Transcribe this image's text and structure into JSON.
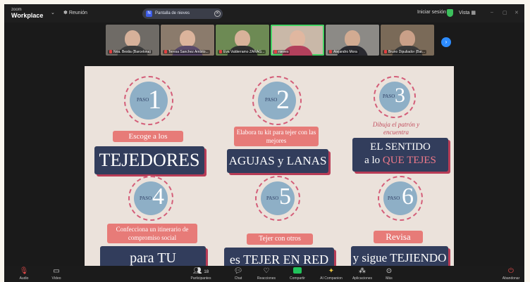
{
  "app": {
    "brand_line1": "zoom",
    "brand_line2": "Workplace"
  },
  "topbar": {
    "meeting_label": "Reunión",
    "share_badge": "N",
    "share_label": "Pantalla de nieves",
    "signin_label": "Iniciar sesión",
    "view_label": "Vista"
  },
  "participants": [
    {
      "name": "Nria. Bestia (Barcelona)",
      "bg": "#6f6b66",
      "skin": "#d6b19a",
      "shirt": "#3c3c3c"
    },
    {
      "name": "Teresa Sanchez Ambito...",
      "bg": "#8b7b6c",
      "skin": "#dcb49c",
      "shirt": "#5a4a6a"
    },
    {
      "name": "Eva Valderramo ZARAG...",
      "bg": "#6d8a54",
      "skin": "#d8b29a",
      "shirt": "#2f2f2f"
    },
    {
      "name": "nieves",
      "bg": "#c9b8a8",
      "skin": "#e0b7a0",
      "shirt": "#b2405c"
    },
    {
      "name": "Alejandro Mora",
      "bg": "#8c8a86",
      "skin": "#d2ab92",
      "shirt": "#2a2a30"
    },
    {
      "name": "Bruno Dipuliador (Bar...",
      "bg": "#7a6a58",
      "skin": "#caa088",
      "shirt": "#3a3a3a"
    }
  ],
  "slide": {
    "paso_label": "PASO",
    "steps": [
      {
        "number": "1",
        "cursive": "Escoge a los",
        "navy": "TEJEDORES"
      },
      {
        "number": "2",
        "cursive": "Elabora tu kit para tejer con las mejores",
        "navy": "AGUJAS y LANAS"
      },
      {
        "number": "3",
        "cursive": "Dibuja el patrón y encuentra",
        "navy_line1": "EL SENTIDO",
        "navy_line2a": "a lo ",
        "navy_line2b": "QUE TEJES"
      },
      {
        "number": "4",
        "cursive": "Confecciona un itinerario de compromiso social",
        "navy": "para TU CENTRO"
      },
      {
        "number": "5",
        "cursive": "Tejer con otros",
        "navy": "es TEJER EN RED"
      },
      {
        "number": "6",
        "cursive": "Revisa",
        "navy": "y sigue TEJIENDO"
      }
    ]
  },
  "toolbar": {
    "audio": "Audio",
    "video": "Vídeo",
    "participants": "Participantes",
    "participants_count": "18",
    "chat": "Chat",
    "reactions": "Reacciones",
    "share": "Compartir",
    "ai": "AI Companion",
    "apps": "Aplicaciones",
    "more": "Más",
    "end": "Abandonar"
  },
  "colors": {
    "accent": "#2d8cff",
    "active_border": "#45d364",
    "navy": "#323d5c",
    "coral": "#e77b78",
    "badge_blue": "#8eafc6"
  }
}
